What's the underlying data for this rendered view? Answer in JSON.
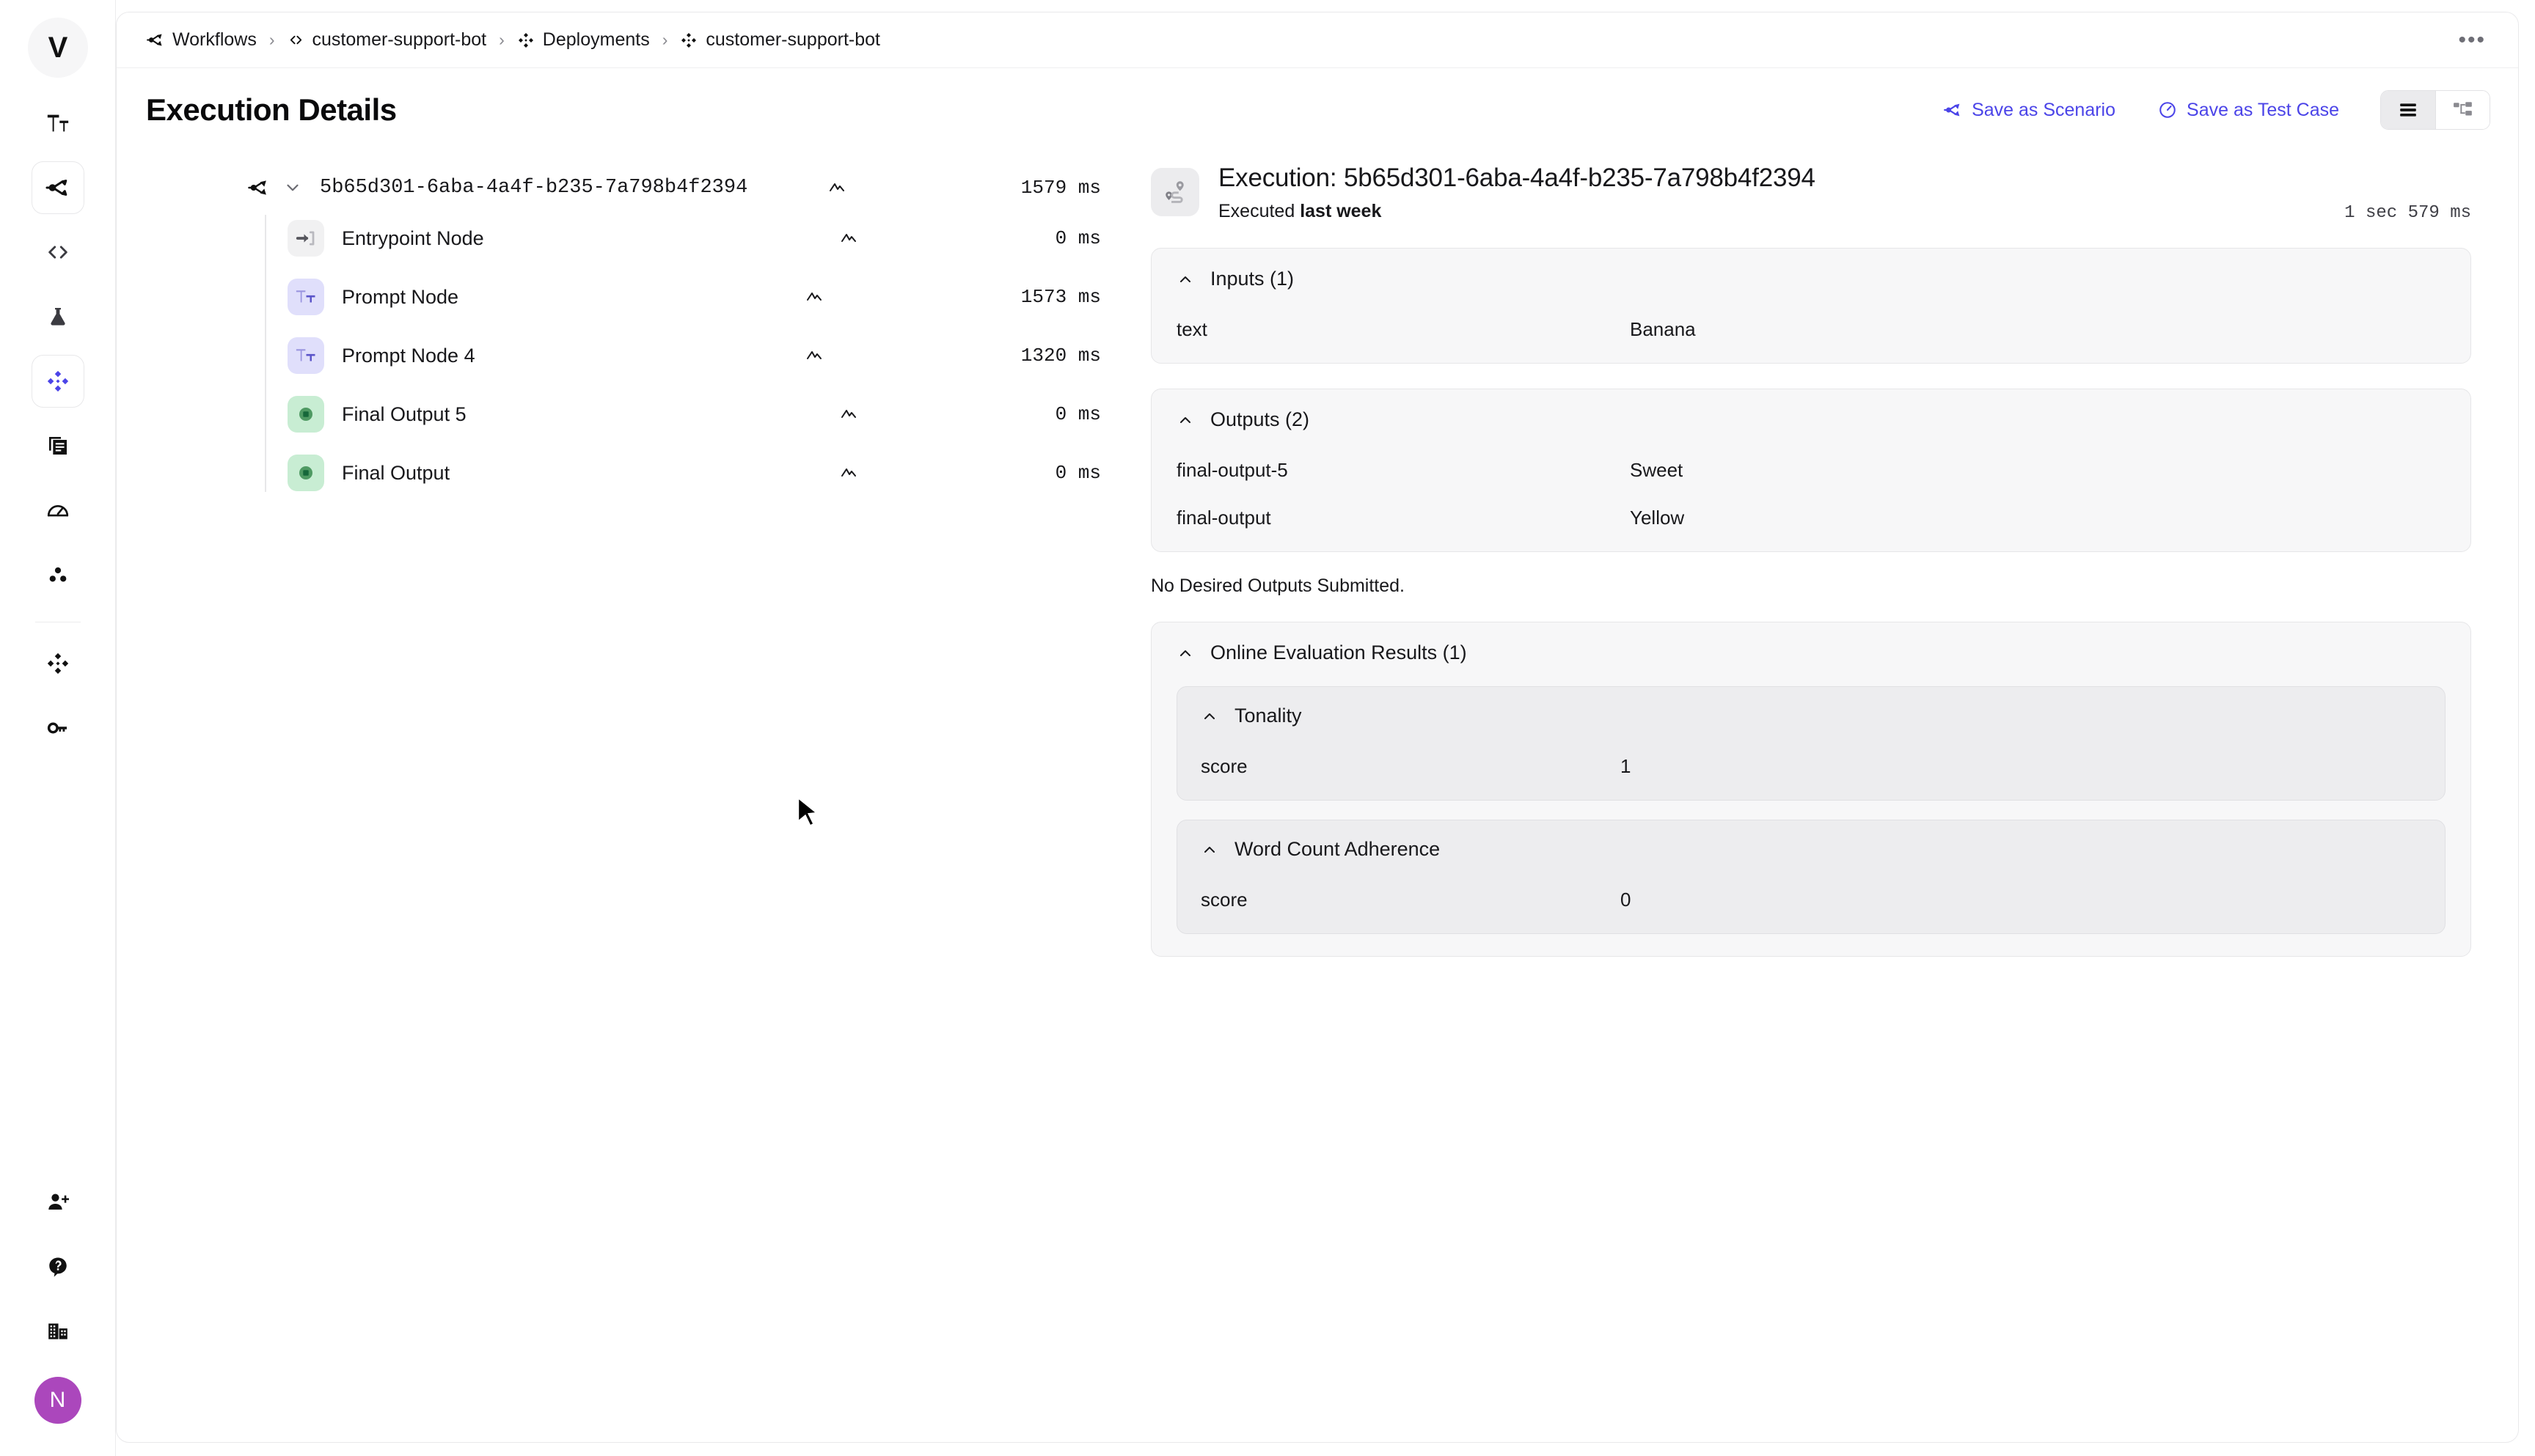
{
  "app": {
    "logo_text": "V",
    "accent_color": "#4b44e8",
    "avatar_letter": "N",
    "avatar_color": "#ab47bc"
  },
  "sidebar": {
    "items": [
      {
        "icon": "text-format-icon",
        "name": "sidebar-item-text-format"
      },
      {
        "icon": "workflows-icon",
        "name": "sidebar-item-workflows",
        "active_box": true
      },
      {
        "icon": "code-icon",
        "name": "sidebar-item-code"
      },
      {
        "icon": "flask-icon",
        "name": "sidebar-item-experiments"
      },
      {
        "icon": "deployments-icon",
        "name": "sidebar-item-deployments",
        "active": true
      },
      {
        "icon": "documents-icon",
        "name": "sidebar-item-documents"
      },
      {
        "icon": "gauge-icon",
        "name": "sidebar-item-evaluations"
      },
      {
        "icon": "cluster-icon",
        "name": "sidebar-item-clusters"
      },
      {
        "icon": "diamond-cluster-icon",
        "name": "sidebar-item-models"
      },
      {
        "icon": "key-icon",
        "name": "sidebar-item-api-keys"
      }
    ],
    "bottom_items": [
      {
        "icon": "add-user-icon",
        "name": "sidebar-item-invite"
      },
      {
        "icon": "help-icon",
        "name": "sidebar-item-help"
      },
      {
        "icon": "organization-icon",
        "name": "sidebar-item-organization"
      }
    ]
  },
  "breadcrumb": {
    "items": [
      {
        "icon": "workflows-icon",
        "label": "Workflows"
      },
      {
        "icon": "code-icon",
        "label": "customer-support-bot"
      },
      {
        "icon": "deployments-icon",
        "label": "Deployments"
      },
      {
        "icon": "deployments-icon",
        "label": "customer-support-bot"
      }
    ],
    "separator": "›",
    "overflow_label": "•••"
  },
  "header": {
    "title": "Execution Details",
    "save_scenario_label": "Save as Scenario",
    "save_test_case_label": "Save as Test Case",
    "view_list_label": "list-view",
    "view_graph_label": "graph-view"
  },
  "tree": {
    "root": {
      "label": "5b65d301-6aba-4a4f-b235-7a798b4f2394",
      "duration": "1579 ms"
    },
    "nodes": [
      {
        "label": "Entrypoint Node",
        "duration": "0 ms",
        "icon": "entrypoint-icon",
        "tone": "gray"
      },
      {
        "label": "Prompt Node",
        "duration": "1573 ms",
        "icon": "prompt-icon",
        "tone": "lav"
      },
      {
        "label": "Prompt Node 4",
        "duration": "1320 ms",
        "icon": "prompt-icon",
        "tone": "lav"
      },
      {
        "label": "Final Output 5",
        "duration": "0 ms",
        "icon": "final-output-icon",
        "tone": "green"
      },
      {
        "label": "Final Output",
        "duration": "0 ms",
        "icon": "final-output-icon",
        "tone": "green"
      }
    ]
  },
  "details": {
    "title": "Execution: 5b65d301-6aba-4a4f-b235-7a798b4f2394",
    "executed_prefix": "Executed ",
    "executed_when": "last week",
    "duration": "1 sec 579 ms",
    "inputs": {
      "title": "Inputs (1)",
      "rows": [
        {
          "key": "text",
          "value": "Banana"
        }
      ]
    },
    "outputs": {
      "title": "Outputs (2)",
      "rows": [
        {
          "key": "final-output-5",
          "value": "Sweet"
        },
        {
          "key": "final-output",
          "value": "Yellow"
        }
      ]
    },
    "desired_outputs_note": "No Desired Outputs Submitted.",
    "evaluation": {
      "title": "Online Evaluation Results (1)",
      "metrics": [
        {
          "title": "Tonality",
          "rows": [
            {
              "key": "score",
              "value": "1"
            }
          ]
        },
        {
          "title": "Word Count Adherence",
          "rows": [
            {
              "key": "score",
              "value": "0"
            }
          ]
        }
      ]
    }
  }
}
